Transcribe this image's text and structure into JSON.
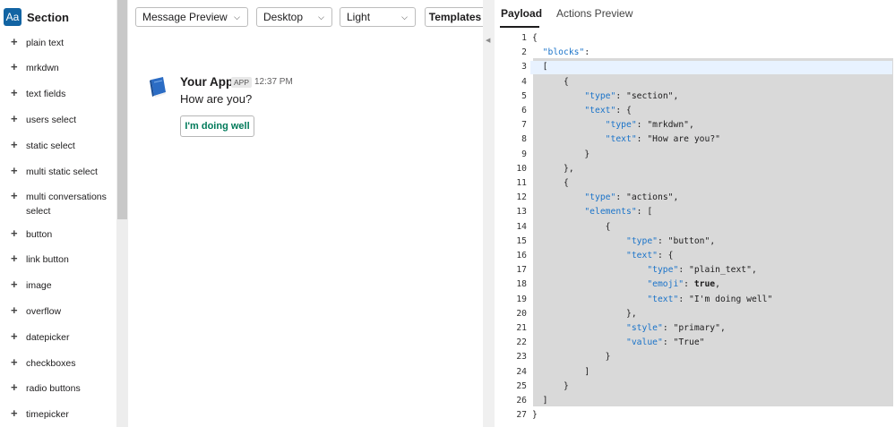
{
  "sidebar": {
    "badge": "Aa",
    "title": "Section",
    "items": [
      {
        "label": "plain text"
      },
      {
        "label": "mrkdwn"
      },
      {
        "label": "text fields"
      },
      {
        "label": "users select"
      },
      {
        "label": "static select"
      },
      {
        "label": "multi static select"
      },
      {
        "label": "multi conversations select"
      },
      {
        "label": "button"
      },
      {
        "label": "link button"
      },
      {
        "label": "image"
      },
      {
        "label": "overflow"
      },
      {
        "label": "datepicker"
      },
      {
        "label": "checkboxes"
      },
      {
        "label": "radio buttons"
      },
      {
        "label": "timepicker"
      }
    ]
  },
  "toolbar": {
    "preview_mode": "Message Preview",
    "device": "Desktop",
    "theme": "Light",
    "templates_label": "Templates"
  },
  "message": {
    "app_name": "Your App",
    "app_tag": "APP",
    "time": "12:37 PM",
    "text": "How are you?",
    "button_label": "I'm doing well",
    "button_color": "#007a5a"
  },
  "right_panel": {
    "tabs": [
      {
        "label": "Payload",
        "active": true
      },
      {
        "label": "Actions Preview",
        "active": false
      }
    ]
  },
  "code": {
    "lines": [
      "{",
      "    \"blocks\":",
      "    [",
      "        {",
      "            \"type\": \"section\",",
      "            \"text\": {",
      "                \"type\": \"mrkdwn\",",
      "                \"text\": \"How are you?\"",
      "            }",
      "        },",
      "        {",
      "            \"type\": \"actions\",",
      "            \"elements\": [",
      "                {",
      "                    \"type\": \"button\",",
      "                    \"text\": {",
      "                        \"type\": \"plain_text\",",
      "                        \"emoji\": true,",
      "                        \"text\": \"I'm doing well\"",
      "                    },",
      "                    \"style\": \"primary\",",
      "                    \"value\": \"True\"",
      "                }",
      "            ]",
      "        }",
      "    ]",
      "}"
    ]
  },
  "colors": {
    "accent": "#1264a3",
    "json_key": "#1a73c9",
    "highlight": "#d9d9d9"
  }
}
